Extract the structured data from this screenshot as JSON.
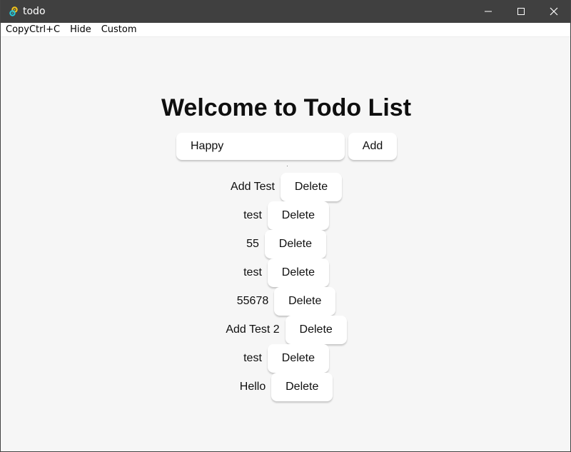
{
  "window": {
    "title": "todo",
    "app_icon": "tauri-icon",
    "controls": [
      "minimize-icon",
      "maximize-icon",
      "close-icon"
    ]
  },
  "menu": {
    "items": [
      "CopyCtrl+C",
      "Hide",
      "Custom"
    ]
  },
  "main": {
    "heading": "Welcome to Todo List",
    "input_value": "Happy",
    "add_label": "Add",
    "todos": [
      {
        "text": "Add Test",
        "delete_label": "Delete"
      },
      {
        "text": "test",
        "delete_label": "Delete"
      },
      {
        "text": "55",
        "delete_label": "Delete"
      },
      {
        "text": "test",
        "delete_label": "Delete"
      },
      {
        "text": "55678",
        "delete_label": "Delete"
      },
      {
        "text": "Add Test 2",
        "delete_label": "Delete"
      },
      {
        "text": "test",
        "delete_label": "Delete"
      },
      {
        "text": "Hello",
        "delete_label": "Delete"
      }
    ]
  },
  "colors": {
    "titlebar": "#404040",
    "background": "#f6f6f6",
    "button": "#ffffff",
    "text": "#0f0f0f"
  }
}
